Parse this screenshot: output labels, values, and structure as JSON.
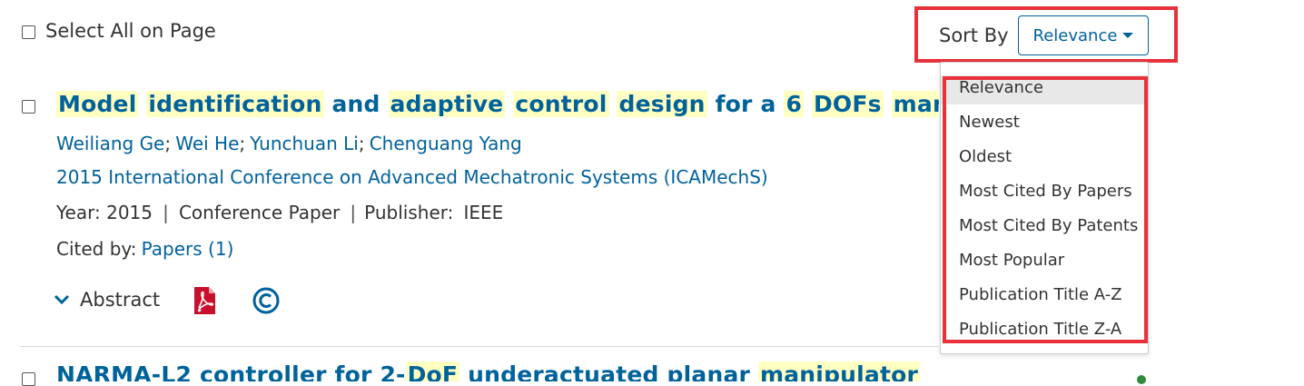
{
  "toolbar": {
    "select_all_label": "Select All on Page",
    "sort_by_label": "Sort By",
    "sort_selected": "Relevance"
  },
  "sort_options": [
    "Relevance",
    "Newest",
    "Oldest",
    "Most Cited By Papers",
    "Most Cited By Patents",
    "Most Popular",
    "Publication Title A-Z",
    "Publication Title Z-A"
  ],
  "result1": {
    "title_words": [
      "Model",
      "identification",
      "and",
      "adaptive",
      "control",
      "design",
      "for a",
      "6",
      "DOFs",
      "manipulato"
    ],
    "authors": [
      "Weiliang Ge",
      "Wei He",
      "Yunchuan Li",
      "Chenguang Yang"
    ],
    "author_sep": ";",
    "venue": "2015 International Conference on Advanced Mechatronic Systems (ICAMechS)",
    "year": "Year: 2015",
    "type": "Conference Paper",
    "publisher_label": "Publisher:",
    "publisher": "IEEE",
    "cited_by_label": "Cited by:",
    "cited_papers": "Papers (1)",
    "abstract_label": "Abstract"
  },
  "result2": {
    "title_partial": [
      "NARMA-L2",
      "controller",
      "for",
      "2-",
      "DoF",
      "underactuated",
      "planar",
      "manipulator"
    ]
  },
  "colors": {
    "link": "#00629b",
    "highlight": "#ffffc2",
    "annotation_red": "#e8313b",
    "pdf_red": "#c8102e"
  }
}
